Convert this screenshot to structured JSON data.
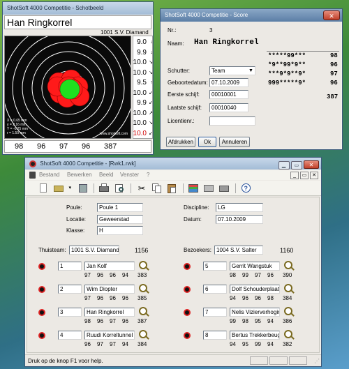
{
  "target_window": {
    "title": "ShotSoft 4000 Competitie - Schotbeeld",
    "shooter_name": "Han Ringkorrel",
    "club": "1001 S.V. Diamand",
    "shots": [
      {
        "score": "9.0",
        "arrow": "↓"
      },
      {
        "score": "9.9",
        "arrow": "↓"
      },
      {
        "score": "10.0",
        "arrow": "↘"
      },
      {
        "score": "10.0",
        "arrow": "↘"
      },
      {
        "score": "9.5",
        "arrow": "↑"
      },
      {
        "score": "10.0",
        "arrow": "↙"
      },
      {
        "score": "9.9",
        "arrow": "↙"
      },
      {
        "score": "10.0",
        "arrow": "↗"
      },
      {
        "score": "10.0",
        "arrow": "↘"
      },
      {
        "score": "10.0",
        "arrow": "↙"
      }
    ],
    "stats": [
      "X = 0.65 mm",
      "y = 2.16 mm",
      "Y = -0.25 mm",
      "r = 1.50 mm"
    ],
    "watermark": "www.shotsoft.com",
    "series_totals": [
      "98",
      "96",
      "97",
      "96",
      "387"
    ],
    "colors": {
      "target_black": "#0a0a0a",
      "hit": "#ff1a1a",
      "last_hit": "#1fe01f",
      "red_score": "#d00000"
    }
  },
  "score_window": {
    "title": "ShotSoft 4000 Competitie - Score",
    "nr_label": "Nr.:",
    "nr_value": "3",
    "naam_label": "Naam:",
    "naam_value": "Han Ringkorrel",
    "schutter_label": "Schutter:",
    "schutter_value": "Team",
    "geboorte_label": "Geboortedatum:",
    "geboorte_value": "07.10.2009",
    "eerste_label": "Eerste schijf:",
    "eerste_value": "00010001",
    "laatste_label": "Laatste schijf:",
    "laatste_value": "00010040",
    "licentie_label": "Licentienr.:",
    "licentie_value": "",
    "score_lines": [
      {
        "marks": "*****99***",
        "total": "98"
      },
      {
        "marks": "*9**99*9**",
        "total": "96"
      },
      {
        "marks": "***9*9**9*",
        "total": "97"
      },
      {
        "marks": "999*****9*",
        "total": "96"
      }
    ],
    "grand_total": "387",
    "buttons": {
      "print": "Afdrukken",
      "ok": "Ok",
      "cancel": "Annuleren"
    }
  },
  "main_window": {
    "title": "ShotSoft 4000 Competitie - [Rwk1.rwk]",
    "menu": [
      "Bestand",
      "Bewerken",
      "Beeld",
      "Venster",
      "?"
    ],
    "poule_label": "Poule:",
    "poule_value": "Poule 1",
    "locatie_label": "Locatie:",
    "locatie_value": "Geweerstad",
    "klasse_label": "Klasse:",
    "klasse_value": "H",
    "discipline_label": "Discipline:",
    "discipline_value": "LG",
    "datum_label": "Datum:",
    "datum_value": "07.10.2009",
    "home": {
      "label": "Thuisteam:",
      "team": "1001 S.V. Diamand",
      "total": "1156",
      "shooters": [
        {
          "nr": "1",
          "name": "Jan Kolf",
          "scores": [
            "97",
            "96",
            "96",
            "94"
          ],
          "total": "383"
        },
        {
          "nr": "2",
          "name": "Wim Diopter",
          "scores": [
            "97",
            "96",
            "96",
            "96"
          ],
          "total": "385"
        },
        {
          "nr": "3",
          "name": "Han Ringkorrel",
          "scores": [
            "98",
            "96",
            "97",
            "96"
          ],
          "total": "387"
        },
        {
          "nr": "4",
          "name": "Ruudi Korreltunnel",
          "scores": [
            "96",
            "97",
            "97",
            "94"
          ],
          "total": "384"
        }
      ]
    },
    "away": {
      "label": "Bezoekers:",
      "team": "1004 S.V. Salter",
      "total": "1160",
      "shooters": [
        {
          "nr": "5",
          "name": "Gerrit Wangstuk",
          "scores": [
            "98",
            "99",
            "97",
            "96"
          ],
          "total": "390"
        },
        {
          "nr": "6",
          "name": "Dolf Schouderplaat",
          "scores": [
            "94",
            "96",
            "96",
            "98"
          ],
          "total": "384"
        },
        {
          "nr": "7",
          "name": "Nelis Vizierverhoging",
          "scores": [
            "99",
            "98",
            "95",
            "94"
          ],
          "total": "386"
        },
        {
          "nr": "8",
          "name": "Bertus Trekkerbeugel",
          "scores": [
            "94",
            "95",
            "99",
            "94"
          ],
          "total": "382"
        }
      ]
    },
    "status": "Druk op de knop F1 voor help."
  }
}
